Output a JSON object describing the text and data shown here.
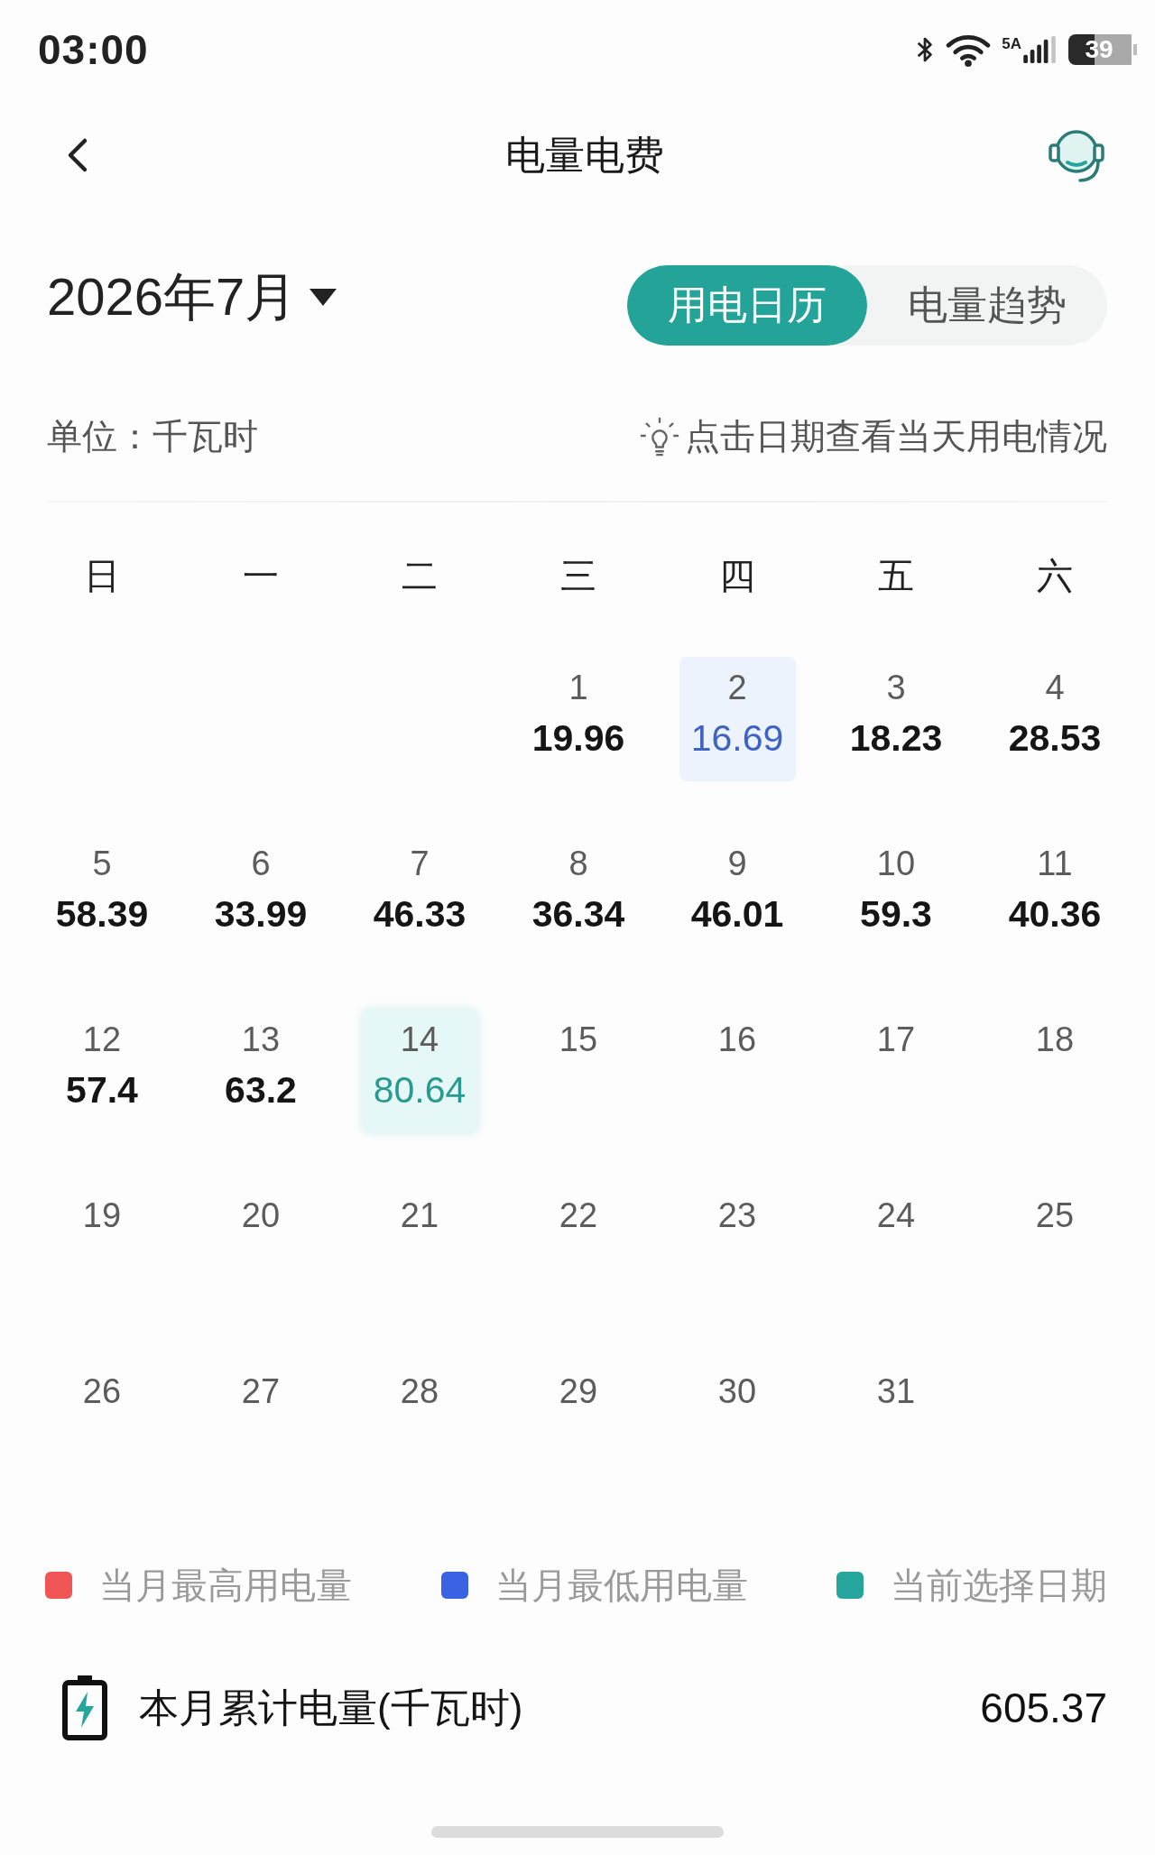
{
  "status_bar": {
    "time": "03:00",
    "network_type": "5A",
    "battery": "39"
  },
  "header": {
    "title": "电量电费"
  },
  "month_picker": {
    "label": "2026年7月"
  },
  "view_tabs": [
    {
      "label": "用电日历",
      "selected": true
    },
    {
      "label": "电量趋势",
      "selected": false
    }
  ],
  "unit_label": "单位：千瓦时",
  "hint": "点击日期查看当天用电情况",
  "weekdays": [
    "日",
    "一",
    "二",
    "三",
    "四",
    "五",
    "六"
  ],
  "calendar": {
    "weeks": [
      [
        {
          "day": "1",
          "usage": "19.96",
          "selected": false,
          "lowest": false
        },
        {
          "day": "2",
          "usage": "16.69",
          "selected": false,
          "lowest": true
        },
        {
          "day": "3",
          "usage": "18.23",
          "selected": false,
          "lowest": false
        },
        {
          "day": "4",
          "usage": "28.53",
          "selected": false,
          "lowest": false
        }
      ],
      [
        {
          "day": "5",
          "usage": "58.39",
          "selected": false,
          "lowest": false
        },
        {
          "day": "6",
          "usage": "33.99",
          "selected": false,
          "lowest": false
        },
        {
          "day": "7",
          "usage": "46.33",
          "selected": false,
          "lowest": false
        },
        {
          "day": "8",
          "usage": "36.34",
          "selected": false,
          "lowest": false
        },
        {
          "day": "9",
          "usage": "46.01",
          "selected": false,
          "lowest": false
        },
        {
          "day": "10",
          "usage": "59.3",
          "selected": false,
          "lowest": false
        },
        {
          "day": "11",
          "usage": "40.36",
          "selected": false,
          "lowest": false
        }
      ],
      [
        {
          "day": "12",
          "usage": "57.4",
          "selected": false,
          "lowest": false
        },
        {
          "day": "13",
          "usage": "63.2",
          "selected": false,
          "lowest": false
        },
        {
          "day": "14",
          "usage": "80.64",
          "selected": true,
          "lowest": false
        },
        {
          "day": "15",
          "selected": false,
          "lowest": false
        },
        {
          "day": "16",
          "selected": false,
          "lowest": false
        },
        {
          "day": "17",
          "selected": false,
          "lowest": false
        },
        {
          "day": "18",
          "selected": false,
          "lowest": false
        }
      ],
      [
        {
          "day": "19",
          "selected": false,
          "lowest": false
        },
        {
          "day": "20",
          "selected": false,
          "lowest": false
        },
        {
          "day": "21",
          "selected": false,
          "lowest": false
        },
        {
          "day": "22",
          "selected": false,
          "lowest": false
        },
        {
          "day": "23",
          "selected": false,
          "lowest": false
        },
        {
          "day": "24",
          "selected": false,
          "lowest": false
        },
        {
          "day": "25",
          "selected": false,
          "lowest": false
        }
      ],
      [
        {
          "day": "26",
          "selected": false,
          "lowest": false
        },
        {
          "day": "27",
          "selected": false,
          "lowest": false
        },
        {
          "day": "28",
          "selected": false,
          "lowest": false
        },
        {
          "day": "29",
          "selected": false,
          "lowest": false
        },
        {
          "day": "30",
          "selected": false,
          "lowest": false
        },
        {
          "day": "31",
          "selected": false,
          "lowest": false
        }
      ]
    ]
  },
  "legend": [
    {
      "label": "当月最高用电量",
      "color": "#f05656"
    },
    {
      "label": "当月最低用电量",
      "color": "#3a62e4"
    },
    {
      "label": "当前选择日期",
      "color": "#25a59b"
    }
  ],
  "total": {
    "label": "本月累计电量(千瓦时)",
    "value": "605.37"
  }
}
